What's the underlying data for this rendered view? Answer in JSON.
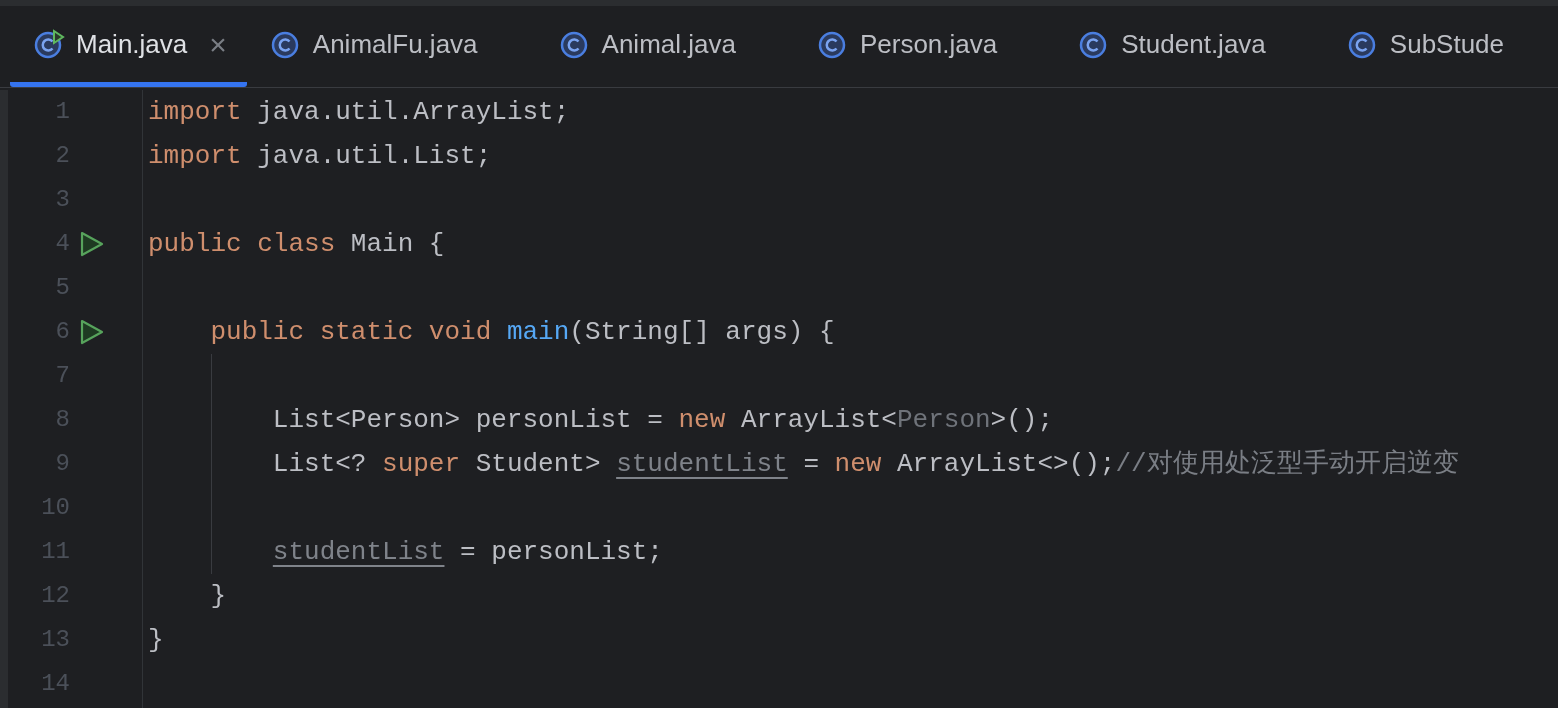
{
  "tabs": [
    {
      "label": "Main.java",
      "selected": true,
      "closable": true,
      "kind": "runnable"
    },
    {
      "label": "AnimalFu.java",
      "selected": false,
      "closable": false,
      "kind": "class"
    },
    {
      "label": "Animal.java",
      "selected": false,
      "closable": false,
      "kind": "class"
    },
    {
      "label": "Person.java",
      "selected": false,
      "closable": false,
      "kind": "class"
    },
    {
      "label": "Student.java",
      "selected": false,
      "closable": false,
      "kind": "class"
    },
    {
      "label": "SubStude",
      "selected": false,
      "closable": false,
      "kind": "class"
    }
  ],
  "close_glyph": "×",
  "lines": [
    {
      "number": "1",
      "run": false,
      "tokens": [
        {
          "kind": "keyword",
          "text": "import"
        },
        {
          "kind": "plain",
          "text": " java.util.ArrayList;"
        }
      ]
    },
    {
      "number": "2",
      "run": false,
      "tokens": [
        {
          "kind": "keyword",
          "text": "import"
        },
        {
          "kind": "plain",
          "text": " java.util.List;"
        }
      ]
    },
    {
      "number": "3",
      "run": false
    },
    {
      "number": "4",
      "run": true,
      "tokens": [
        {
          "kind": "keyword",
          "text": "public class"
        },
        {
          "kind": "plain",
          "text": " Main {"
        }
      ]
    },
    {
      "number": "5",
      "run": false
    },
    {
      "number": "6",
      "run": true,
      "tokens": [
        {
          "kind": "keyword",
          "text": "    public static void "
        },
        {
          "kind": "method",
          "text": "main"
        },
        {
          "kind": "plain",
          "text": "(String[] args) {"
        }
      ]
    },
    {
      "number": "7",
      "run": false
    },
    {
      "number": "8",
      "run": false,
      "tokens": [
        {
          "kind": "plain",
          "text": "        List<Person> personList = "
        },
        {
          "kind": "keyword",
          "text": "new"
        },
        {
          "kind": "plain",
          "text": " ArrayList<"
        },
        {
          "kind": "muted",
          "text": "Person"
        },
        {
          "kind": "plain",
          "text": ">();"
        }
      ]
    },
    {
      "number": "9",
      "run": false,
      "tokens": [
        {
          "kind": "plain",
          "text": "        List<? "
        },
        {
          "kind": "keyword",
          "text": "super"
        },
        {
          "kind": "plain",
          "text": " Student> "
        },
        {
          "kind": "unused",
          "text": "studentList"
        },
        {
          "kind": "plain",
          "text": " = "
        },
        {
          "kind": "keyword",
          "text": "new"
        },
        {
          "kind": "plain",
          "text": " ArrayList<>();"
        },
        {
          "kind": "comment",
          "text": "//对使用处泛型手动开启逆变"
        }
      ]
    },
    {
      "number": "10",
      "run": false
    },
    {
      "number": "11",
      "run": false,
      "tokens": [
        {
          "kind": "unused",
          "text": "        studentList"
        },
        {
          "kind": "plain",
          "text": " = personList;"
        }
      ]
    },
    {
      "number": "12",
      "run": false,
      "tokens": [
        {
          "kind": "plain",
          "text": "    }"
        }
      ]
    },
    {
      "number": "13",
      "run": false,
      "tokens": [
        {
          "kind": "plain",
          "text": "}"
        }
      ]
    },
    {
      "number": "14",
      "run": false
    }
  ]
}
